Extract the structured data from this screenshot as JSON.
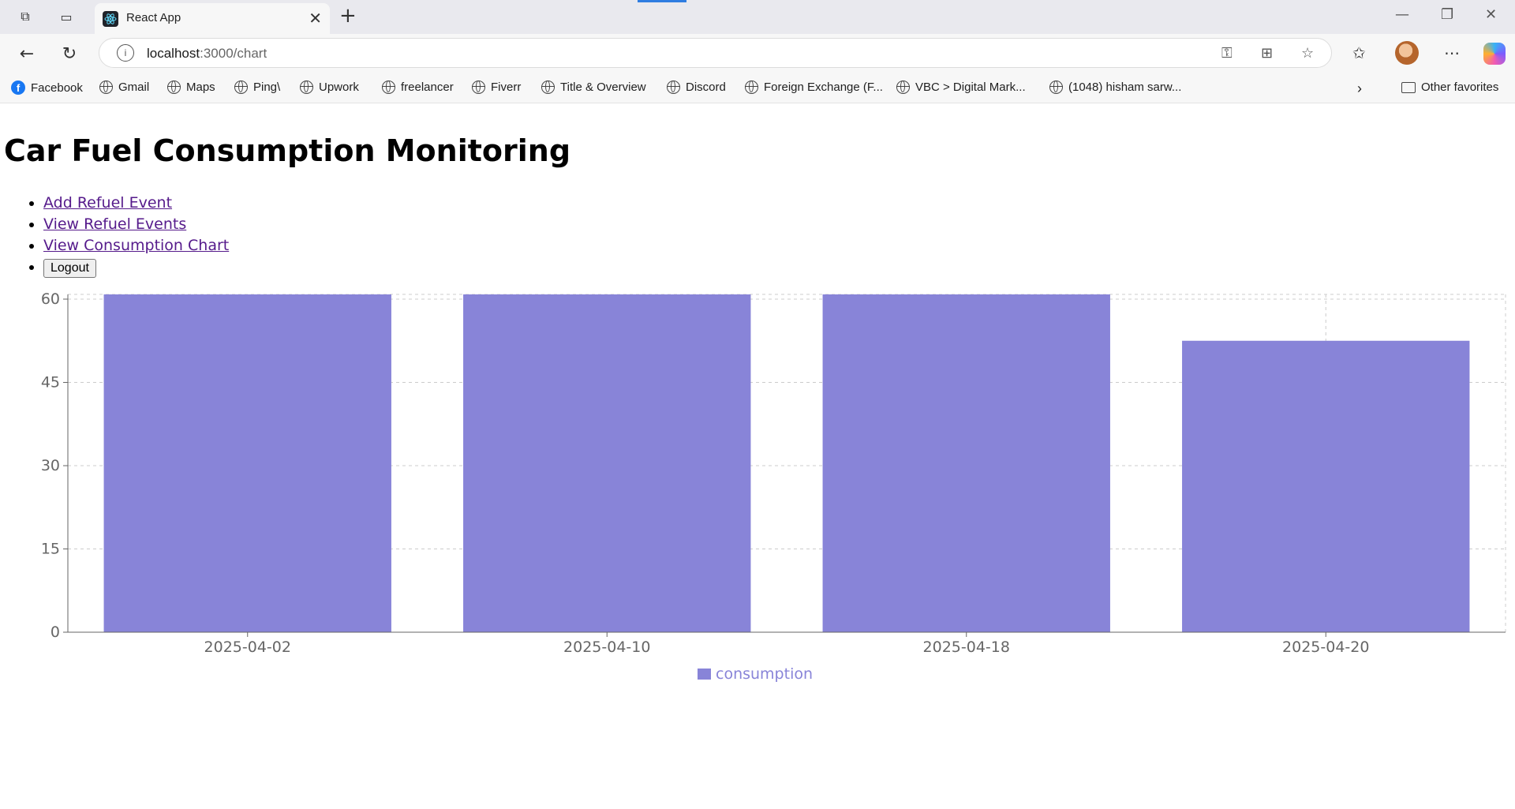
{
  "browser": {
    "tab_title": "React App",
    "address_host": "localhost",
    "address_path": ":3000/chart",
    "bookmarks": [
      "Facebook",
      "Gmail",
      "Maps",
      "Ping\\",
      "Upwork",
      "freelancer",
      "Fiverr",
      "Title & Overview",
      "Discord",
      "Foreign Exchange (F...",
      "VBC > Digital Mark...",
      "(1048) hisham sarw..."
    ],
    "other_favorites": "Other favorites"
  },
  "page": {
    "title": "Car Fuel Consumption Monitoring",
    "nav": [
      "Add Refuel Event",
      "View Refuel Events",
      "View Consumption Chart"
    ],
    "logout_label": "Logout"
  },
  "chart_data": {
    "type": "bar",
    "categories": [
      "2025-04-02",
      "2025-04-10",
      "2025-04-18",
      "2025-04-20"
    ],
    "series": [
      {
        "name": "consumption",
        "values": [
          61,
          61,
          61,
          52.5
        ],
        "color": "#8884d8"
      }
    ],
    "ylim": [
      0,
      60
    ],
    "yticks": [
      0,
      15,
      30,
      45,
      60
    ],
    "grid": true,
    "legend": "bottom-center"
  }
}
